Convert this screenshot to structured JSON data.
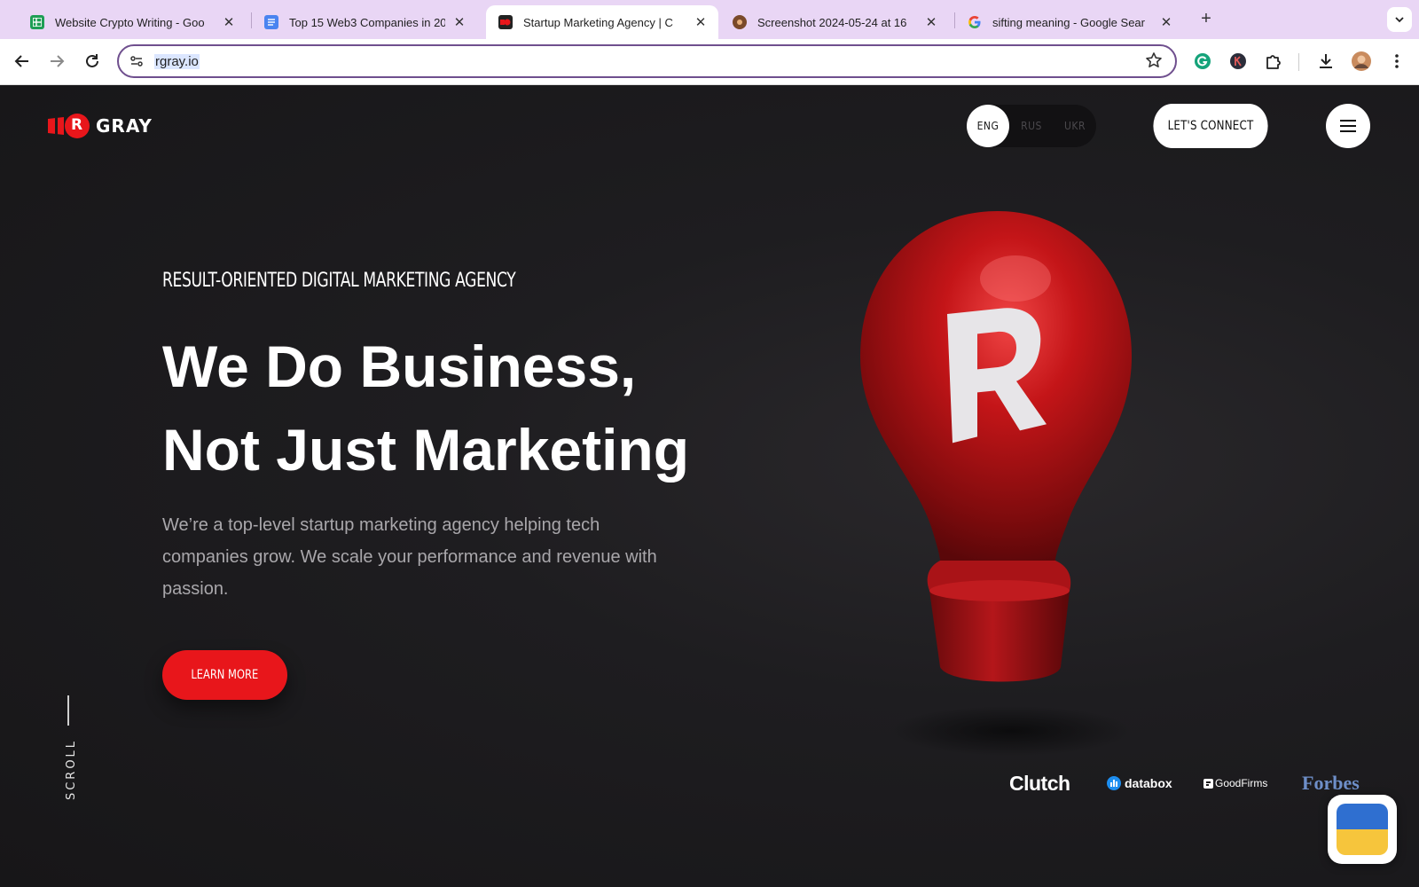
{
  "browser": {
    "tabs": [
      {
        "title": "Website Crypto Writing - Goo",
        "icon": "google-sheets-icon",
        "active": false
      },
      {
        "title": "Top 15 Web3 Companies in 20",
        "icon": "google-docs-icon",
        "active": false
      },
      {
        "title": "Startup Marketing Agency | C",
        "icon": "rgray-favicon",
        "active": true
      },
      {
        "title": "Screenshot 2024-05-24 at 16",
        "icon": "image-favicon",
        "active": false
      },
      {
        "title": "sifting meaning - Google Sear",
        "icon": "google-icon",
        "active": false
      }
    ],
    "close_glyph": "✕",
    "new_tab_glyph": "+",
    "url": "rgray.io"
  },
  "site": {
    "logo_text": "GRAY",
    "logo_letter": "R",
    "languages": [
      {
        "code": "ENG",
        "selected": true
      },
      {
        "code": "RUS",
        "selected": false
      },
      {
        "code": "UKR",
        "selected": false
      }
    ],
    "connect_label": "LET'S CONNECT",
    "eyebrow": "RESULT-ORIENTED DIGITAL MARKETING AGENCY",
    "headline_line1": "We Do Business,",
    "headline_line2": "Not Just Marketing",
    "lead": "We’re a top-level startup marketing agency helping tech companies grow. We scale your performance and revenue with passion.",
    "cta_label": "LEARN MORE",
    "scroll_label": "SCROLL",
    "bulb_letter": "R",
    "partners": {
      "clutch": "Clutch",
      "databox": "databox",
      "goodfirms": "GoodFirms",
      "forbes": "Forbes"
    }
  },
  "colors": {
    "brand_red": "#e8161b",
    "tabbar_bg": "#e9d6f5",
    "page_bg": "#1b1a1c",
    "ukraine_blue": "#2f6fd0",
    "ukraine_yellow": "#f6c53c"
  }
}
